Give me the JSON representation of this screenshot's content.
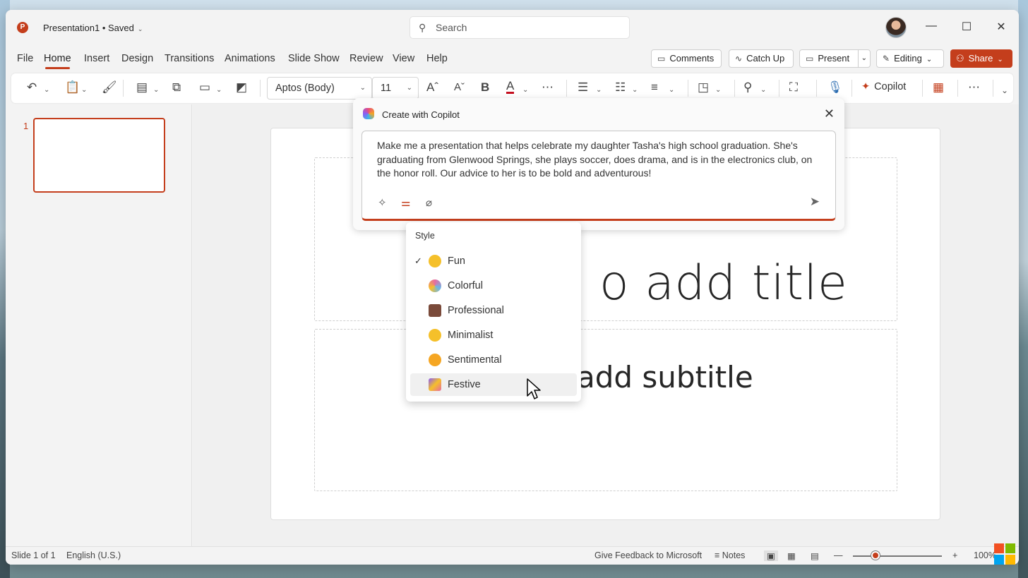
{
  "app": {
    "logo_letter": "P",
    "doc_title": "Presentation1 • Saved",
    "accent_color": "#c43e1c"
  },
  "search": {
    "placeholder": "Search"
  },
  "menu": {
    "tabs": [
      "File",
      "Home",
      "Insert",
      "Design",
      "Transitions",
      "Animations",
      "Slide Show",
      "Review",
      "View",
      "Help"
    ],
    "active_tab": "Home",
    "comments_label": "Comments",
    "catchup_label": "Catch Up",
    "present_label": "Present",
    "editing_label": "Editing",
    "share_label": "Share"
  },
  "ribbon": {
    "font_name": "Aptos (Body)",
    "font_size": "11",
    "copilot_label": "Copilot"
  },
  "slides_pane": {
    "slide_number": "1"
  },
  "slide": {
    "title_placeholder": "o add title",
    "subtitle_placeholder": "add subtitle"
  },
  "copilot": {
    "title": "Create with Copilot",
    "prompt": "Make me a presentation that helps celebrate my daughter Tasha's high school graduation. She's graduating from Glenwood Springs, she plays soccer, does drama, and is in the electronics club, on the honor roll. Our advice to her is to be bold and adventurous!"
  },
  "style_menu": {
    "header": "Style",
    "items": [
      {
        "label": "Fun",
        "checked": true,
        "icon": "grinning-face-icon",
        "color": "#f5c02a"
      },
      {
        "label": "Colorful",
        "checked": false,
        "icon": "lollipop-icon",
        "color": "#e86aa0"
      },
      {
        "label": "Professional",
        "checked": false,
        "icon": "briefcase-icon",
        "color": "#7a4a3a"
      },
      {
        "label": "Minimalist",
        "checked": false,
        "icon": "slight-smile-icon",
        "color": "#f5c02a"
      },
      {
        "label": "Sentimental",
        "checked": false,
        "icon": "hugging-face-icon",
        "color": "#f5a623"
      },
      {
        "label": "Festive",
        "checked": false,
        "icon": "party-popper-icon",
        "color": "#8a5cf6"
      }
    ],
    "hovered": "Festive"
  },
  "status": {
    "slide_info": "Slide 1 of 1",
    "language": "English (U.S.)",
    "feedback": "Give Feedback to Microsoft",
    "notes": "Notes",
    "zoom": "100%"
  }
}
